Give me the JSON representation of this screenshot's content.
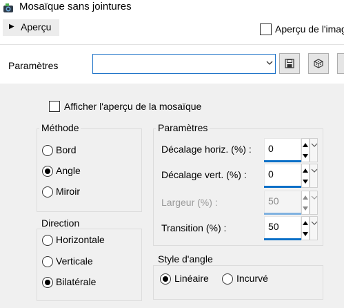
{
  "window": {
    "title": "Mosaïque sans jointures"
  },
  "preview": {
    "toggle_label": "Aperçu",
    "checkbox_label": "Aperçu de l'image"
  },
  "params": {
    "label": "Paramètres",
    "combo_value": ""
  },
  "show_tile_preview": {
    "label": "Afficher l'aperçu de la mosaïque",
    "checked": false
  },
  "method": {
    "title": "Méthode",
    "options": [
      {
        "label": "Bord",
        "selected": false
      },
      {
        "label": "Angle",
        "selected": true
      },
      {
        "label": "Miroir",
        "selected": false
      }
    ]
  },
  "settings": {
    "title": "Paramètres",
    "fields": [
      {
        "label": "Décalage horiz. (%) :",
        "value": "0",
        "enabled": true
      },
      {
        "label": "Décalage vert. (%) :",
        "value": "0",
        "enabled": true
      },
      {
        "label": "Largeur (%) :",
        "value": "50",
        "enabled": false
      },
      {
        "label": "Transition (%) :",
        "value": "50",
        "enabled": true
      }
    ]
  },
  "direction": {
    "title": "Direction",
    "options": [
      {
        "label": "Horizontale",
        "selected": false
      },
      {
        "label": "Verticale",
        "selected": false
      },
      {
        "label": "Bilatérale",
        "selected": true
      }
    ]
  },
  "corner_style": {
    "title": "Style d'angle",
    "options": [
      {
        "label": "Linéaire",
        "selected": true
      },
      {
        "label": "Incurvé",
        "selected": false
      }
    ]
  },
  "colors": {
    "accent": "#0b6fc7",
    "panel": "#f0f0f0"
  }
}
